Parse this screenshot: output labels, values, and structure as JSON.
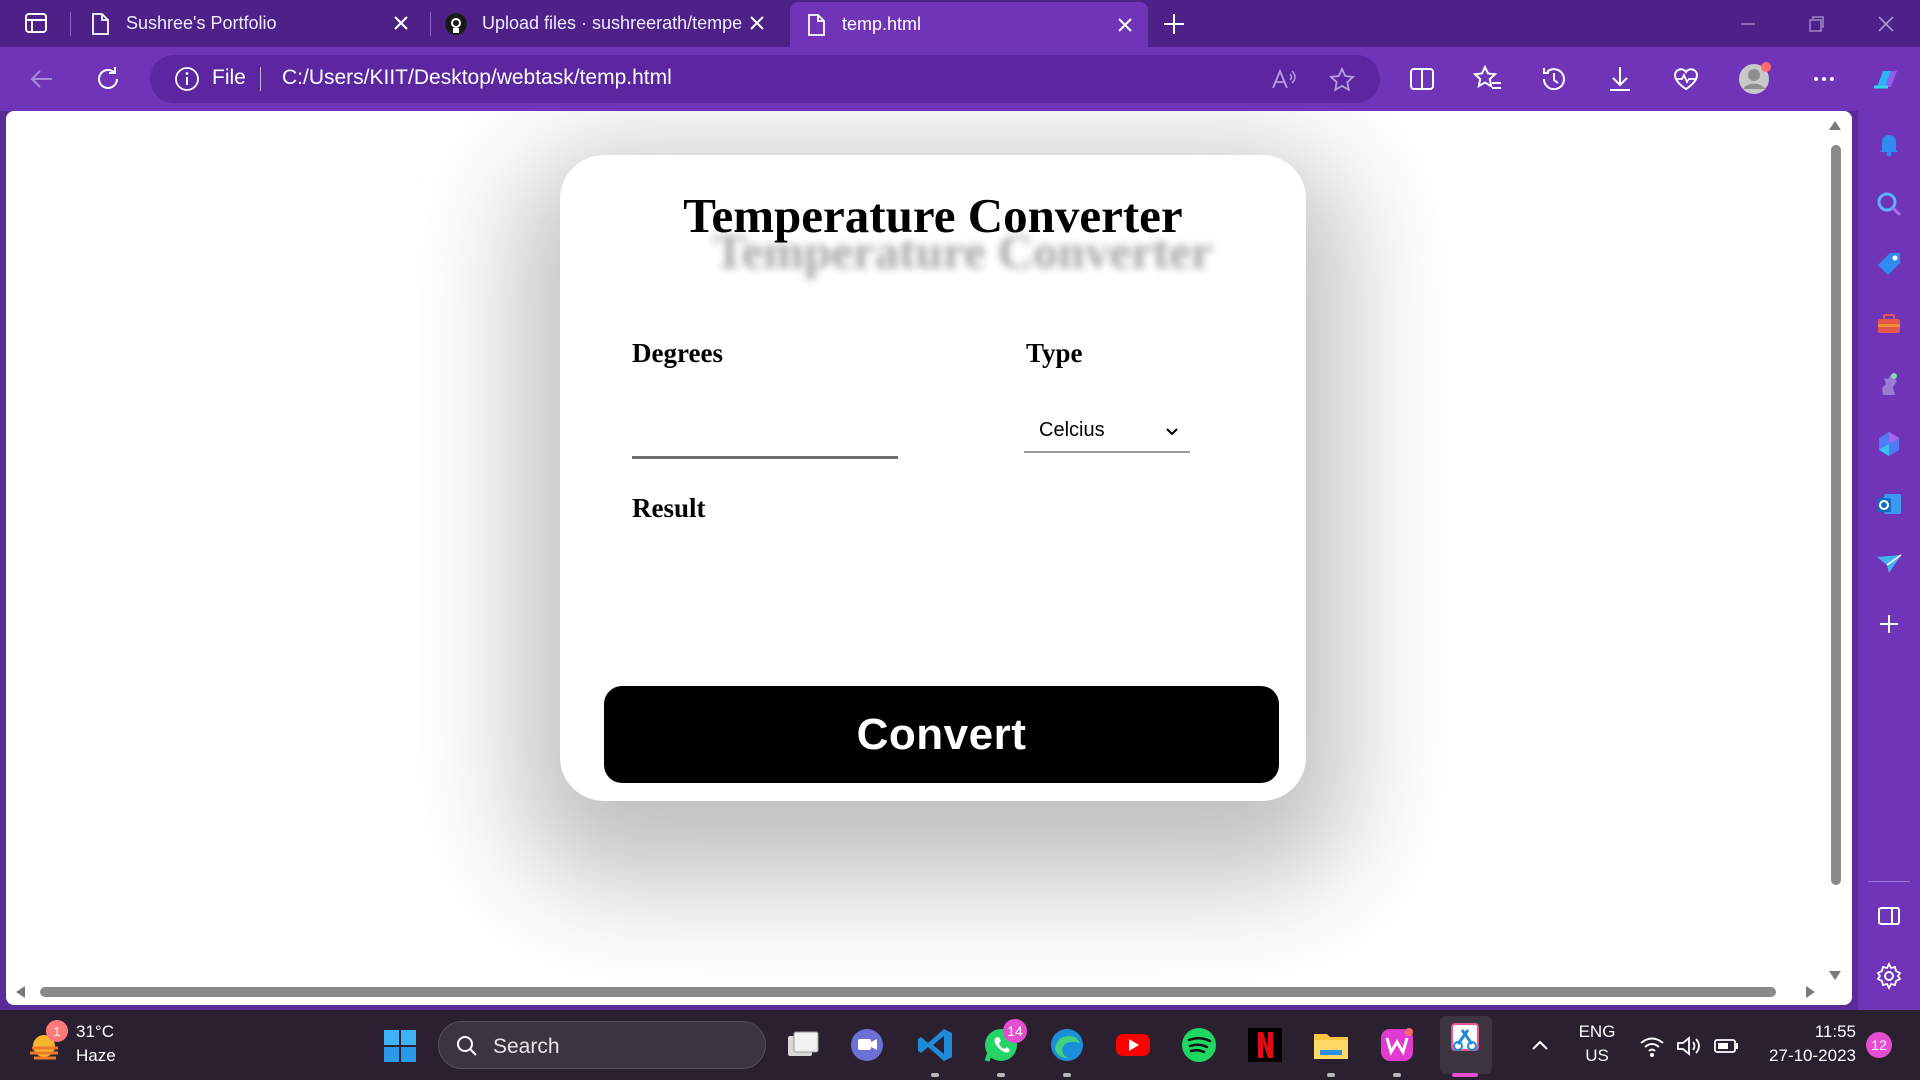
{
  "browser": {
    "tabs": [
      {
        "label": "Sushree's Portfolio",
        "icon": "page-icon",
        "active": false
      },
      {
        "label": "Upload files · sushreerath/tempe",
        "icon": "github-icon",
        "active": false
      },
      {
        "label": "temp.html",
        "icon": "page-icon",
        "active": true
      }
    ],
    "address": {
      "scheme": "File",
      "url": "C:/Users/KIIT/Desktop/webtask/temp.html"
    },
    "accent": "#6f34b7"
  },
  "page": {
    "title": "Temperature Converter",
    "degrees_label": "Degrees",
    "degrees_value": "",
    "type_label": "Type",
    "type_selected": "Celcius",
    "result_label": "Result",
    "convert_label": "Convert"
  },
  "taskbar": {
    "weather": {
      "temp": "31°C",
      "desc": "Haze",
      "badge": "1"
    },
    "search_placeholder": "Search",
    "whatsapp_badge": "14",
    "language": {
      "lang": "ENG",
      "region": "US"
    },
    "clock": {
      "time": "11:55",
      "date": "27-10-2023"
    },
    "notifications": "12"
  }
}
